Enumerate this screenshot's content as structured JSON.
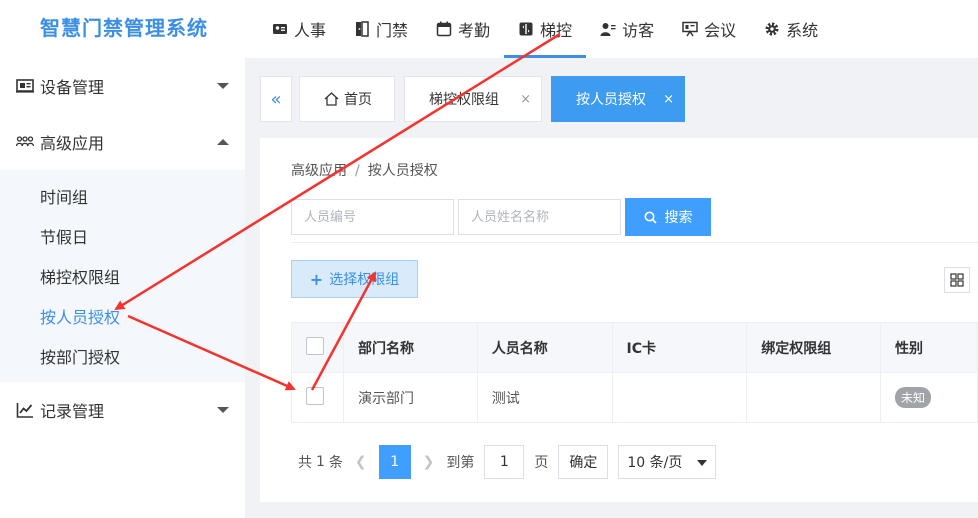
{
  "app": {
    "title": "智慧门禁管理系统"
  },
  "topnav": [
    {
      "label": "人事",
      "icon": "person-card-icon"
    },
    {
      "label": "门禁",
      "icon": "door-icon"
    },
    {
      "label": "考勤",
      "icon": "calendar-icon"
    },
    {
      "label": "梯控",
      "icon": "elevator-icon",
      "active": true
    },
    {
      "label": "访客",
      "icon": "visitor-icon"
    },
    {
      "label": "会议",
      "icon": "meeting-icon"
    },
    {
      "label": "系统",
      "icon": "gear-icon"
    }
  ],
  "sidebar": {
    "groups": [
      {
        "label": "设备管理",
        "icon": "device-icon",
        "expanded": false
      },
      {
        "label": "高级应用",
        "icon": "users-icon",
        "expanded": true,
        "items": [
          "时间组",
          "节假日",
          "梯控权限组",
          "按人员授权",
          "按部门授权"
        ],
        "active_item": "按人员授权"
      },
      {
        "label": "记录管理",
        "icon": "chart-icon",
        "expanded": false
      }
    ]
  },
  "tabs": {
    "items": [
      {
        "label": "首页",
        "icon": "home-icon",
        "closable": false
      },
      {
        "label": "梯控权限组",
        "closable": true
      },
      {
        "label": "按人员授权",
        "closable": true,
        "active": true
      }
    ],
    "close_glyph": "×"
  },
  "breadcrumb": {
    "parent": "高级应用",
    "sep": "/",
    "current": "按人员授权"
  },
  "search": {
    "person_no_placeholder": "人员编号",
    "person_name_placeholder": "人员姓名名称",
    "button_label": "搜索"
  },
  "toolbar": {
    "select_perm_label": "选择权限组"
  },
  "table": {
    "headers": [
      "部门名称",
      "人员名称",
      "IC卡",
      "绑定权限组",
      "性别"
    ],
    "rows": [
      {
        "dept": "演示部门",
        "name": "测试",
        "ic": "",
        "perm": "",
        "gender": "未知"
      }
    ]
  },
  "pagination": {
    "total_prefix": "共",
    "total": "1",
    "total_suffix": "条",
    "current_page": "1",
    "goto_prefix": "到第",
    "goto_value": "1",
    "goto_suffix": "页",
    "confirm_label": "确定",
    "page_size": "10 条/页"
  },
  "colors": {
    "accent": "#3d8fe6",
    "arrow": "#f5322d"
  }
}
